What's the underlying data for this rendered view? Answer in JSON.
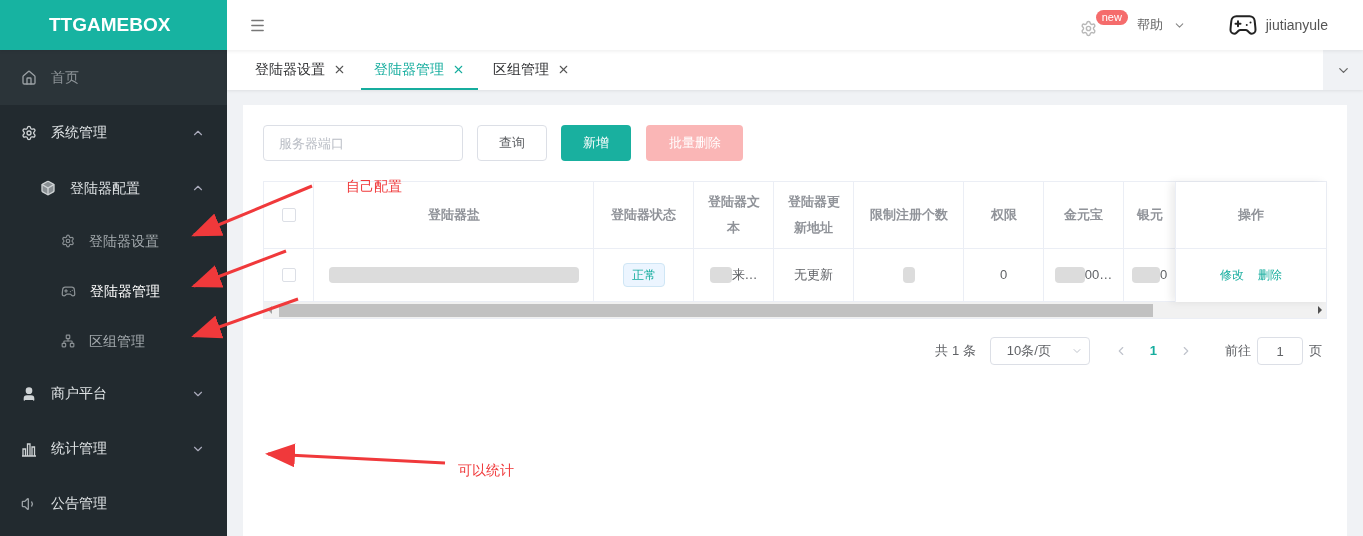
{
  "brand": "TTGAMEBOX",
  "header": {
    "badge": "new",
    "help": "帮助",
    "user": "jiutianyule"
  },
  "sidebar": {
    "items": [
      {
        "label": "首页",
        "highlighted": true
      },
      {
        "label": "系统管理",
        "kind": "group",
        "expanded": true,
        "children": [
          {
            "label": "登陆器配置",
            "expanded": true,
            "children": [
              {
                "label": "登陆器设置",
                "selected": false
              },
              {
                "label": "登陆器管理",
                "selected": true
              },
              {
                "label": "区组管理",
                "selected": false
              }
            ]
          }
        ]
      },
      {
        "label": "商户平台",
        "kind": "group",
        "expanded": false
      },
      {
        "label": "统计管理",
        "kind": "group",
        "expanded": false
      },
      {
        "label": "公告管理"
      }
    ]
  },
  "tabs": [
    {
      "label": "登陆器设置",
      "selected": false
    },
    {
      "label": "登陆器管理",
      "selected": true
    },
    {
      "label": "区组管理",
      "selected": false
    }
  ],
  "toolbar": {
    "search": {
      "placeholder": "服务器端口"
    },
    "query": "查询",
    "add": "新增",
    "batch_delete": {
      "label": "批量删除",
      "disabled": true
    }
  },
  "table": {
    "select_all_checked": false,
    "columns": [
      "登陆器盐",
      "登陆器状态",
      "登陆器文本",
      "登陆器更新地址",
      "限制注册个数",
      "权限",
      "金元宝",
      "银元",
      "操作"
    ],
    "rows": [
      {
        "checked": false,
        "status": "正常",
        "text": "来…",
        "update": "无更新",
        "permission": "0",
        "gold": "00…",
        "silver": "0",
        "actions": [
          "修改",
          "删除"
        ]
      }
    ]
  },
  "pagination": {
    "total": "共 1 条",
    "page_size": "10条/页",
    "pages": [
      {
        "label": "1",
        "selected": true
      }
    ],
    "goto": "前往",
    "goto_value": "1",
    "page_unit": "页"
  },
  "annotations": [
    {
      "text": "自己配置"
    },
    {
      "text": "可以统计"
    }
  ]
}
